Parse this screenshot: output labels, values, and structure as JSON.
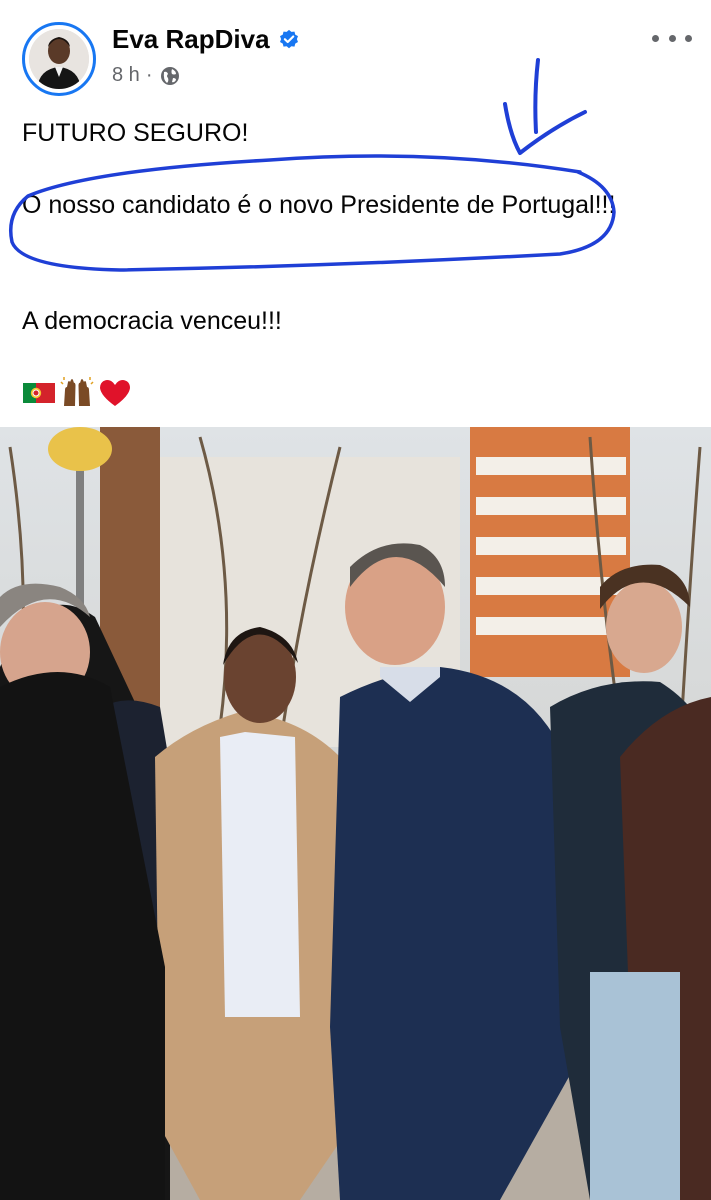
{
  "post": {
    "author": "Eva RapDiva",
    "time": "8 h",
    "separator": "·",
    "line1": "FUTURO SEGURO!",
    "line2": "O nosso candidato é o novo Presidente de Portugal!!!",
    "line3": "A democracia venceu!!!",
    "emojis": [
      "portugal-flag",
      "raising-hands",
      "red-heart"
    ]
  },
  "colors": {
    "verified": "#1877f2",
    "annotation": "#1f3fd6",
    "secondary_text": "#65676b"
  }
}
